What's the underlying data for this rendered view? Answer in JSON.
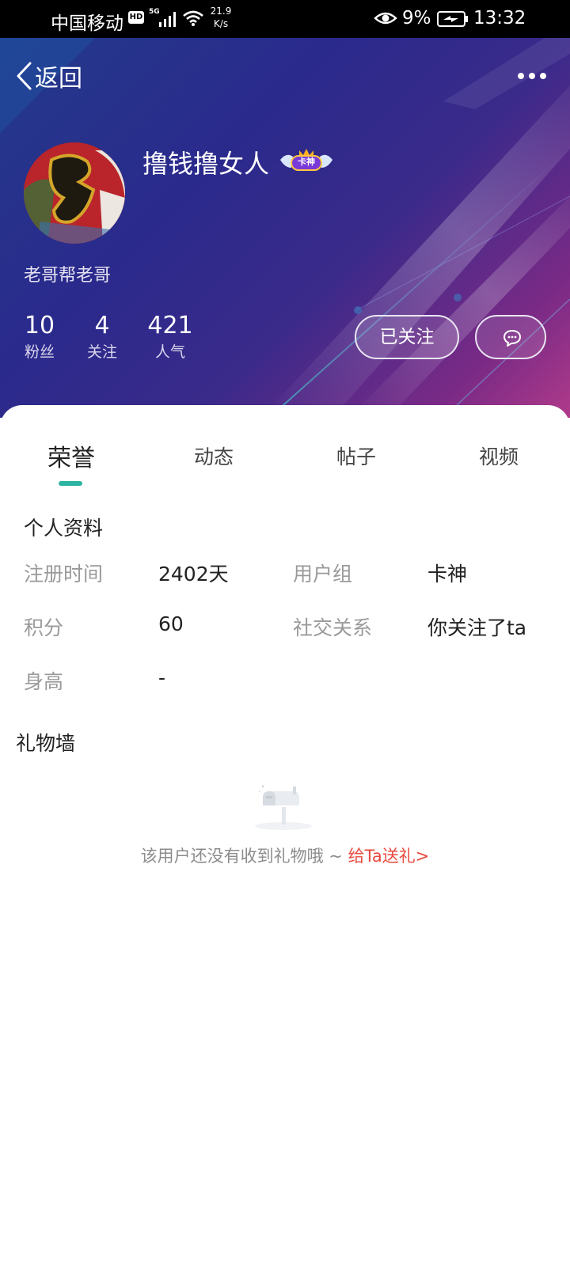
{
  "status_bar": {
    "carrier": "中国移动",
    "hd": "HD",
    "network": "5G",
    "speed_value": "21.9",
    "speed_unit": "K/s",
    "battery": "9%",
    "time": "13:32"
  },
  "header": {
    "back_label": "返回",
    "more_icon": "more-dots-icon"
  },
  "profile": {
    "username": "撸钱撸女人",
    "badge": "卡神",
    "signature": "老哥帮老哥",
    "stats": [
      {
        "value": "10",
        "label": "粉丝"
      },
      {
        "value": "4",
        "label": "关注"
      },
      {
        "value": "421",
        "label": "人气"
      }
    ],
    "follow_button": "已关注",
    "message_icon": "chat-bubble-icon"
  },
  "tabs": [
    {
      "label": "荣誉",
      "active": true
    },
    {
      "label": "动态",
      "active": false
    },
    {
      "label": "帖子",
      "active": false
    },
    {
      "label": "视频",
      "active": false
    }
  ],
  "personal_info": {
    "title": "个人资料",
    "fields": [
      {
        "label": "注册时间",
        "value": "2402天"
      },
      {
        "label": "用户组",
        "value": "卡神"
      },
      {
        "label": "积分",
        "value": "60"
      },
      {
        "label": "社交关系",
        "value": "你关注了ta"
      },
      {
        "label": "身高",
        "value": "-"
      }
    ]
  },
  "gift_wall": {
    "title": "礼物墙",
    "empty_text": "该用户还没有收到礼物哦 ~ ",
    "link_text": "给Ta送礼>"
  },
  "colors": {
    "accent": "#2bb5a2",
    "link": "#e8493e"
  }
}
